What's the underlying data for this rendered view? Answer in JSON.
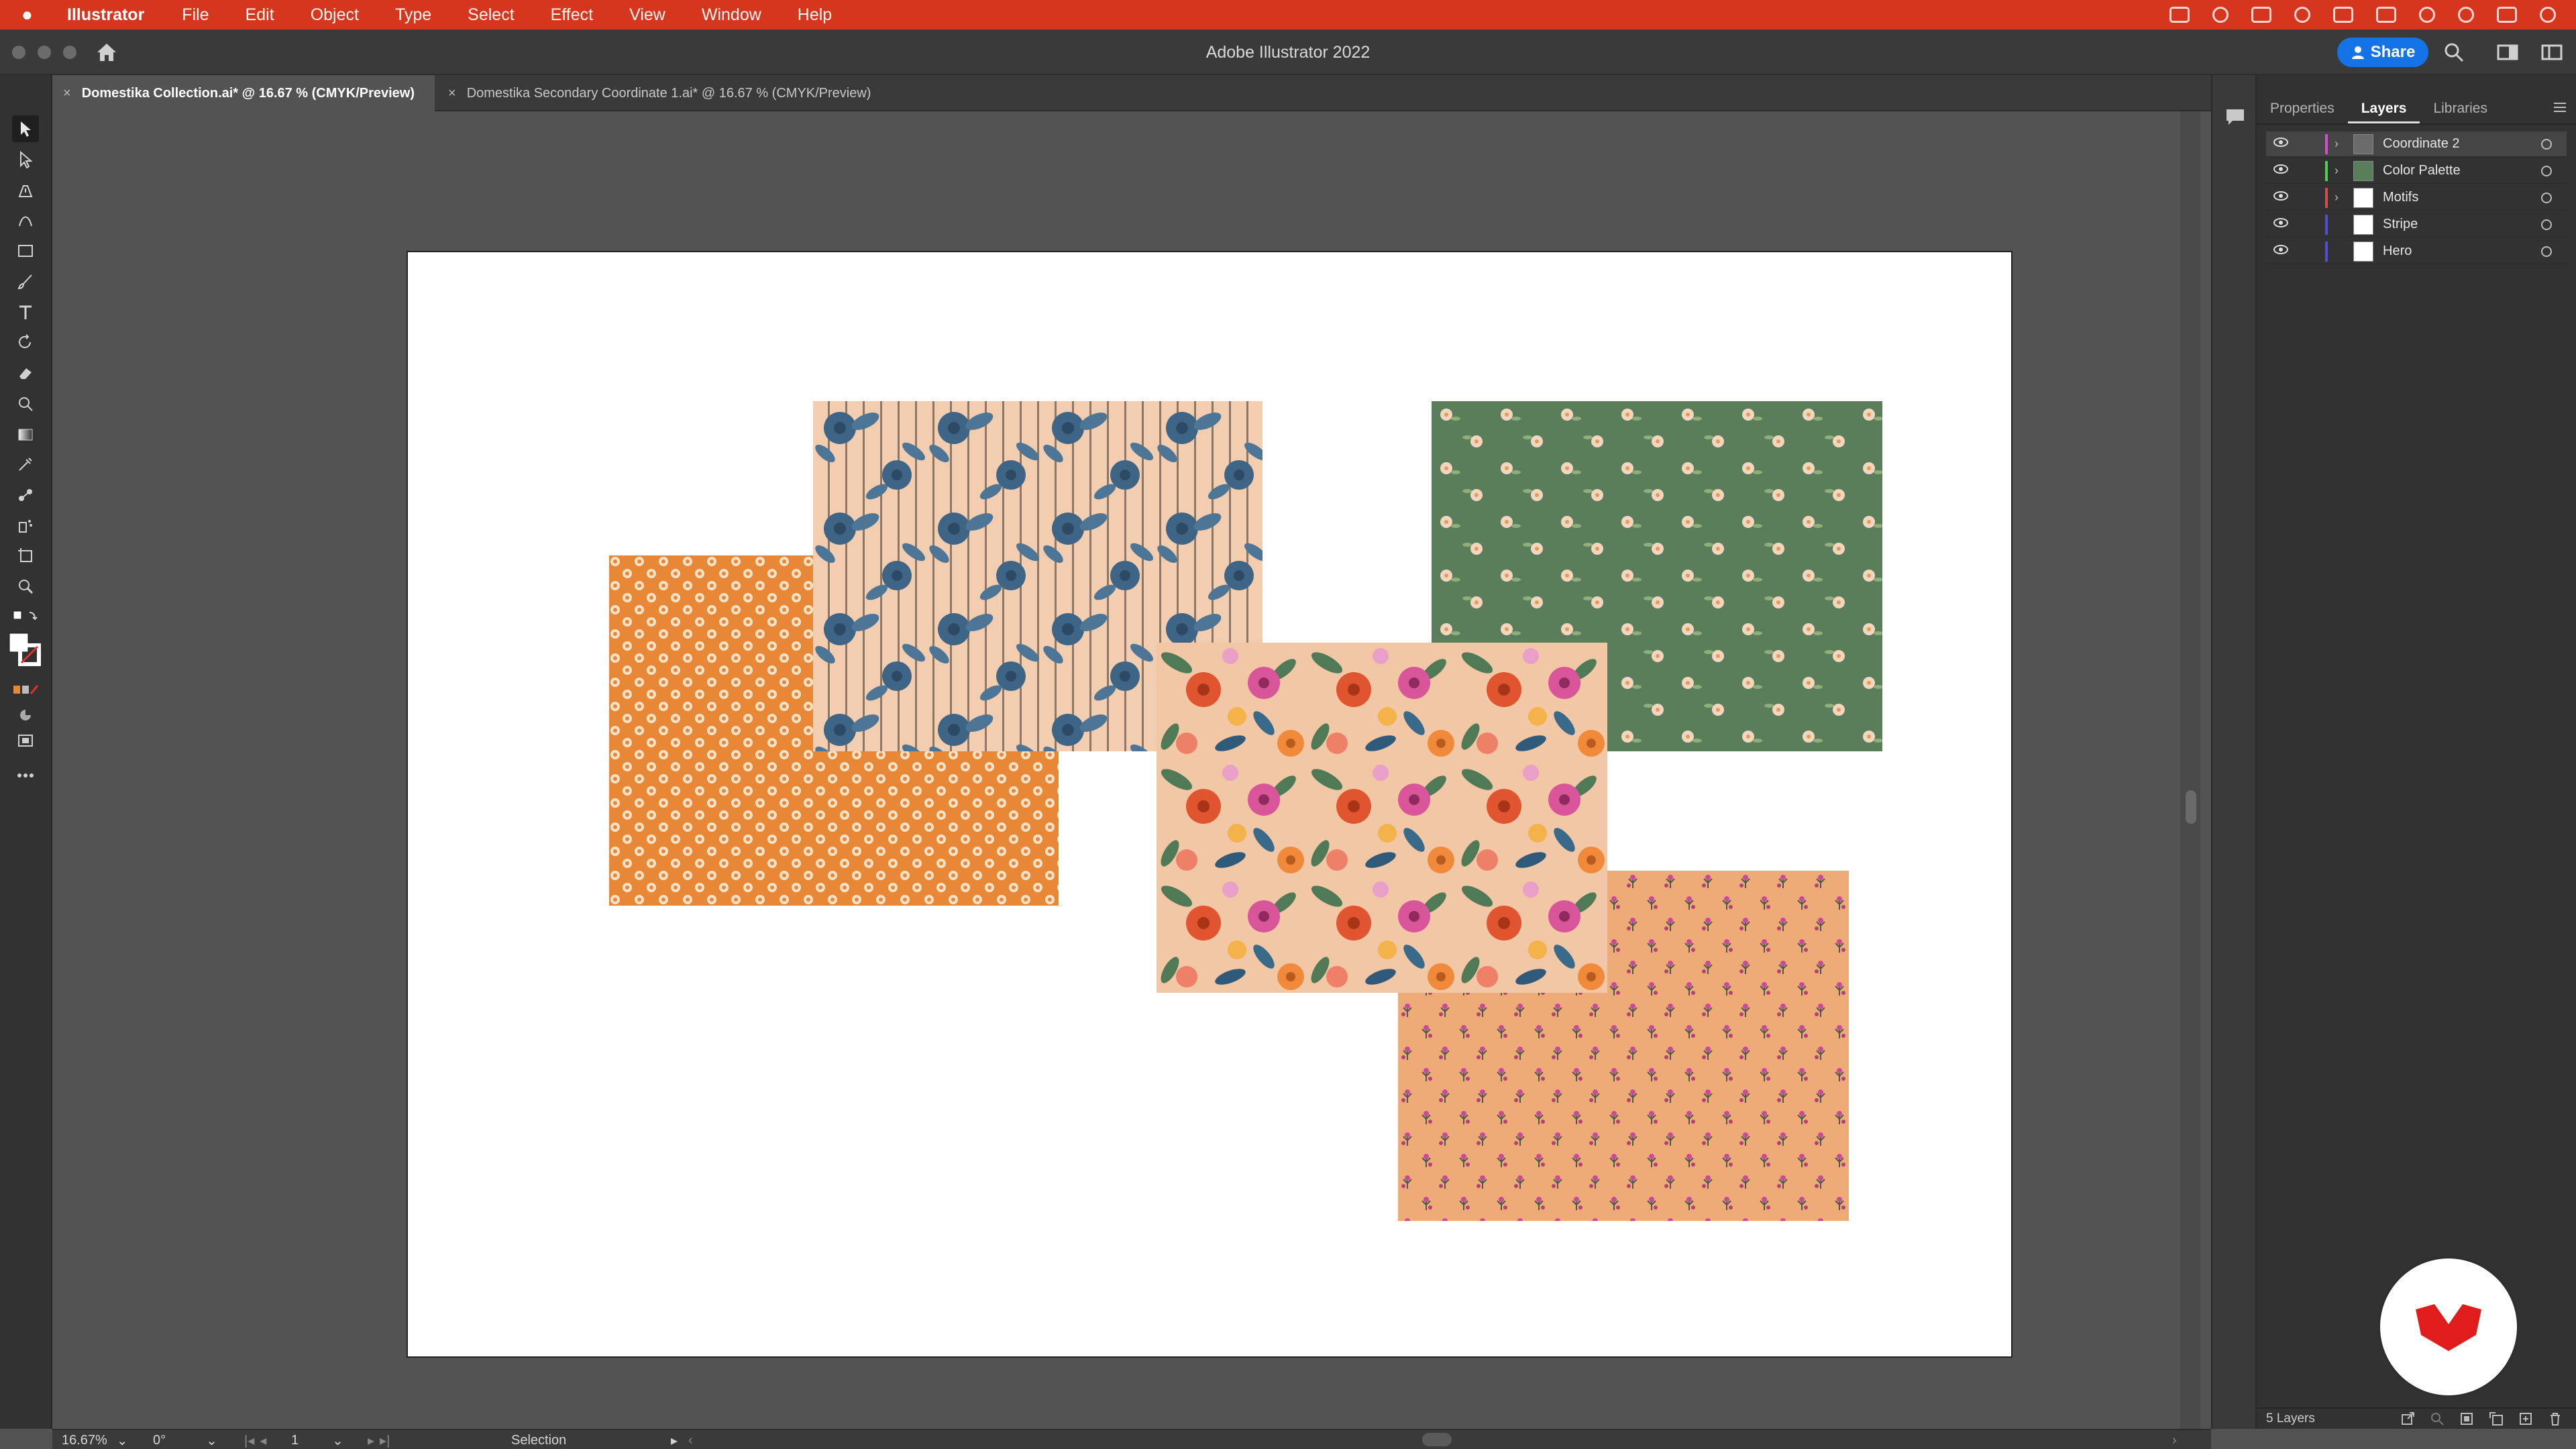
{
  "menubar": {
    "app_name": "Illustrator",
    "items": [
      "File",
      "Edit",
      "Object",
      "Type",
      "Select",
      "Effect",
      "View",
      "Window",
      "Help"
    ]
  },
  "window": {
    "title": "Adobe Illustrator 2022",
    "share_label": "Share"
  },
  "tabs": [
    {
      "close": "×",
      "label": "Domestika Collection.ai* @ 16.67 % (CMYK/Preview)"
    },
    {
      "close": "×",
      "label": "Domestika Secondary Coordinate 1.ai* @ 16.67 % (CMYK/Preview)"
    }
  ],
  "panel": {
    "tabs": [
      "Properties",
      "Layers",
      "Libraries"
    ],
    "layers": [
      {
        "name": "Coordinate 2",
        "color": "#cf4fd0",
        "expandable": true
      },
      {
        "name": "Color Palette",
        "color": "#4fcf4f",
        "expandable": true
      },
      {
        "name": "Motifs",
        "color": "#cf4f4f",
        "expandable": true
      },
      {
        "name": "Stripe",
        "color": "#4f4fcf",
        "expandable": false
      },
      {
        "name": "Hero",
        "color": "#4f4fcf",
        "expandable": false
      }
    ],
    "footer_count": "5 Layers"
  },
  "statusbar": {
    "zoom": "16.67%",
    "rotation": "0°",
    "artboard_number": "1",
    "tool": "Selection"
  },
  "colors": {
    "menubar": "#d6361d",
    "share": "#1473e6",
    "green_pattern": "#5a7d5a",
    "orange_pattern": "#e88836",
    "peach_pattern": "#eeab78",
    "stripe_pattern": "#f2cdb0",
    "navy_flower": "#3e6486"
  }
}
